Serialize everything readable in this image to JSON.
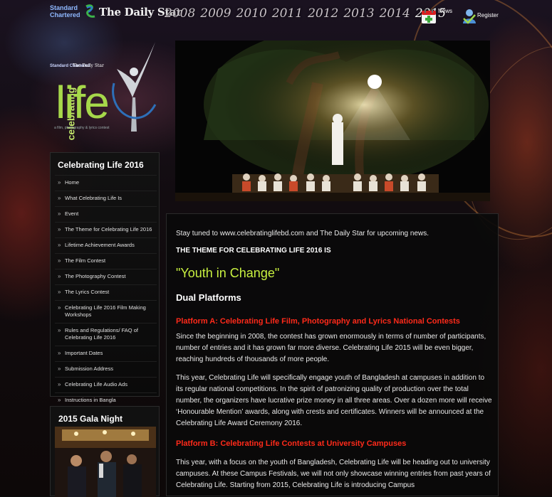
{
  "topbar": {
    "sponsor_logo": "Standard Chartered",
    "paper_logo": "The Daily Star",
    "years": [
      "2008",
      "2009",
      "2010",
      "2011",
      "2012",
      "2013",
      "2014",
      "2015"
    ],
    "news_label": "News",
    "register_label": "Register"
  },
  "brand": {
    "sponsor": "Standard Chartered",
    "paper": "The Daily Star",
    "celebrating": "celebrating",
    "life": "life",
    "tagline": "a film, photography & lyrics contest"
  },
  "sidebar": {
    "title": "Celebrating Life 2016",
    "items": [
      {
        "label": "Home"
      },
      {
        "label": "What Celebrating Life Is"
      },
      {
        "label": "Event"
      },
      {
        "label": "The Theme for Celebrating Life 2016"
      },
      {
        "label": "Lifetime Achievement Awards"
      },
      {
        "label": "The Film Contest"
      },
      {
        "label": "The Photography Contest"
      },
      {
        "label": "The Lyrics Contest"
      },
      {
        "label": "Celebrating Life 2016 Film Making Workshops"
      },
      {
        "label": "Rules and Regulations/ FAQ of Celebrating Life 2016"
      },
      {
        "label": "Important Dates"
      },
      {
        "label": "Submission Address"
      },
      {
        "label": "Celebrating Life Audio Ads"
      },
      {
        "label": "Instructions in Bangla"
      }
    ]
  },
  "gala": {
    "title": "2015 Gala Night"
  },
  "content": {
    "intro": "Stay tuned to www.celebratinglifebd.com and The Daily Star for upcoming news.",
    "theme_heading": "THE THEME FOR CELEBRATING LIFE 2016 IS",
    "theme_title": "\"Youth in Change\"",
    "dual_heading": "Dual Platforms",
    "platform_a_heading": "Platform A: Celebrating Life Film, Photography and Lyrics National Contests",
    "platform_a_p1": "Since the beginning in 2008, the contest has grown enormously in terms of number of participants, number of entries and it has grown far more diverse. Celebrating Life 2015 will be even bigger, reaching hundreds of thousands of more people.",
    "platform_a_p2": "This year, Celebrating Life will specifically engage youth of Bangladesh at campuses in addition to its regular national competitions. In the spirit of patronizing quality of production over the total number, the organizers have lucrative prize money in all three areas. Over a dozen more will receive ‘Honourable Mention’ awards, along with crests and certificates. Winners will be announced at the Celebrating Life Award Ceremony 2016.",
    "platform_b_heading": "Platform B: Celebrating Life Contests at University Campuses",
    "platform_b_p1": "This year, with a focus on the youth of Bangladesh, Celebrating Life will be heading out to university campuses. At these Campus Festivals, we will not only showcase winning entries from past years of Celebrating Life. Starting from 2015, Celebrating Life is introducing Campus"
  },
  "colors": {
    "accent_green": "#c8f040",
    "heading_red": "#ff2a1a",
    "panel_bg": "#0a0a0a"
  }
}
